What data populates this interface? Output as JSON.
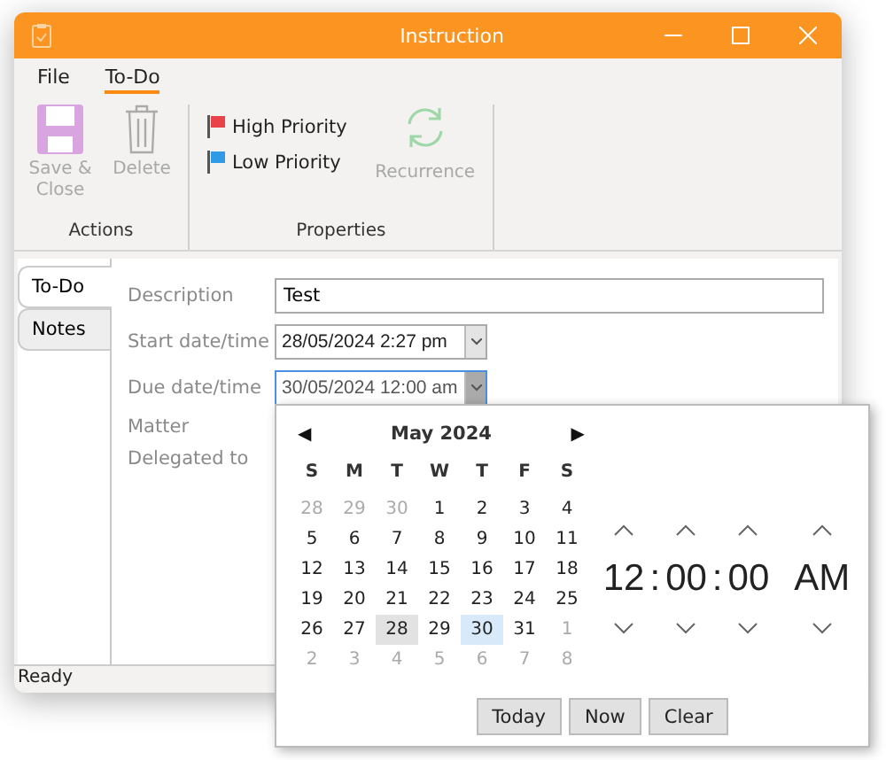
{
  "window": {
    "title": "Instruction"
  },
  "menu": [
    {
      "label": "File",
      "selected": false
    },
    {
      "label": "To-Do",
      "selected": true
    }
  ],
  "ribbon": {
    "groups": [
      {
        "label": "Actions",
        "items": [
          {
            "kind": "save",
            "label": "Save & Close",
            "disabled": true
          },
          {
            "kind": "delete",
            "label": "Delete",
            "disabled": true
          }
        ]
      },
      {
        "label": "Properties",
        "items": [
          {
            "kind": "flags",
            "flags": [
              {
                "label": "High Priority",
                "color": "#e8434b"
              },
              {
                "label": "Low Priority",
                "color": "#2f9be6"
              }
            ]
          },
          {
            "kind": "recurrence",
            "label": "Recurrence",
            "disabled": true
          }
        ]
      }
    ]
  },
  "side_tabs": [
    {
      "label": "To-Do",
      "selected": true
    },
    {
      "label": "Notes",
      "selected": false
    }
  ],
  "form": [
    {
      "label": "Description",
      "kind": "text",
      "value": "Test"
    },
    {
      "label": "Start date/time",
      "kind": "date",
      "value": "28/05/2024 2:27 pm",
      "open": false
    },
    {
      "label": "Due date/time",
      "kind": "date",
      "value": "30/05/2024 12:00 am",
      "open": true
    },
    {
      "label": "Matter",
      "kind": "hidden"
    },
    {
      "label": "Delegated to",
      "kind": "hidden"
    }
  ],
  "calendar": {
    "prev": "◀",
    "month": "May 2024",
    "next": "▶",
    "weekdays": [
      "S",
      "M",
      "T",
      "W",
      "T",
      "F",
      "S"
    ],
    "weeks": [
      [
        {
          "day": "28",
          "muted": true,
          "today": false,
          "selected": false
        },
        {
          "day": "29",
          "muted": true,
          "today": false,
          "selected": false
        },
        {
          "day": "30",
          "muted": true,
          "today": false,
          "selected": false
        },
        {
          "day": "1",
          "muted": false,
          "today": false,
          "selected": false
        },
        {
          "day": "2",
          "muted": false,
          "today": false,
          "selected": false
        },
        {
          "day": "3",
          "muted": false,
          "today": false,
          "selected": false
        },
        {
          "day": "4",
          "muted": false,
          "today": false,
          "selected": false
        }
      ],
      [
        {
          "day": "5",
          "muted": false,
          "today": false,
          "selected": false
        },
        {
          "day": "6",
          "muted": false,
          "today": false,
          "selected": false
        },
        {
          "day": "7",
          "muted": false,
          "today": false,
          "selected": false
        },
        {
          "day": "8",
          "muted": false,
          "today": false,
          "selected": false
        },
        {
          "day": "9",
          "muted": false,
          "today": false,
          "selected": false
        },
        {
          "day": "10",
          "muted": false,
          "today": false,
          "selected": false
        },
        {
          "day": "11",
          "muted": false,
          "today": false,
          "selected": false
        }
      ],
      [
        {
          "day": "12",
          "muted": false,
          "today": false,
          "selected": false
        },
        {
          "day": "13",
          "muted": false,
          "today": false,
          "selected": false
        },
        {
          "day": "14",
          "muted": false,
          "today": false,
          "selected": false
        },
        {
          "day": "15",
          "muted": false,
          "today": false,
          "selected": false
        },
        {
          "day": "16",
          "muted": false,
          "today": false,
          "selected": false
        },
        {
          "day": "17",
          "muted": false,
          "today": false,
          "selected": false
        },
        {
          "day": "18",
          "muted": false,
          "today": false,
          "selected": false
        }
      ],
      [
        {
          "day": "19",
          "muted": false,
          "today": false,
          "selected": false
        },
        {
          "day": "20",
          "muted": false,
          "today": false,
          "selected": false
        },
        {
          "day": "21",
          "muted": false,
          "today": false,
          "selected": false
        },
        {
          "day": "22",
          "muted": false,
          "today": false,
          "selected": false
        },
        {
          "day": "23",
          "muted": false,
          "today": false,
          "selected": false
        },
        {
          "day": "24",
          "muted": false,
          "today": false,
          "selected": false
        },
        {
          "day": "25",
          "muted": false,
          "today": false,
          "selected": false
        }
      ],
      [
        {
          "day": "26",
          "muted": false,
          "today": false,
          "selected": false
        },
        {
          "day": "27",
          "muted": false,
          "today": false,
          "selected": false
        },
        {
          "day": "28",
          "muted": false,
          "today": true,
          "selected": false
        },
        {
          "day": "29",
          "muted": false,
          "today": false,
          "selected": false
        },
        {
          "day": "30",
          "muted": false,
          "today": false,
          "selected": true
        },
        {
          "day": "31",
          "muted": false,
          "today": false,
          "selected": false
        },
        {
          "day": "1",
          "muted": true,
          "today": false,
          "selected": false
        }
      ],
      [
        {
          "day": "2",
          "muted": true,
          "today": false,
          "selected": false
        },
        {
          "day": "3",
          "muted": true,
          "today": false,
          "selected": false
        },
        {
          "day": "4",
          "muted": true,
          "today": false,
          "selected": false
        },
        {
          "day": "5",
          "muted": true,
          "today": false,
          "selected": false
        },
        {
          "day": "6",
          "muted": true,
          "today": false,
          "selected": false
        },
        {
          "day": "7",
          "muted": true,
          "today": false,
          "selected": false
        },
        {
          "day": "8",
          "muted": true,
          "today": false,
          "selected": false
        }
      ]
    ]
  },
  "time": {
    "hour": "12",
    "separator_1": ":",
    "minute": "00",
    "separator_2": ":",
    "second": "00",
    "meridiem": "AM"
  },
  "popup_buttons": [
    "Today",
    "Now",
    "Clear"
  ],
  "status_bar": "Ready"
}
